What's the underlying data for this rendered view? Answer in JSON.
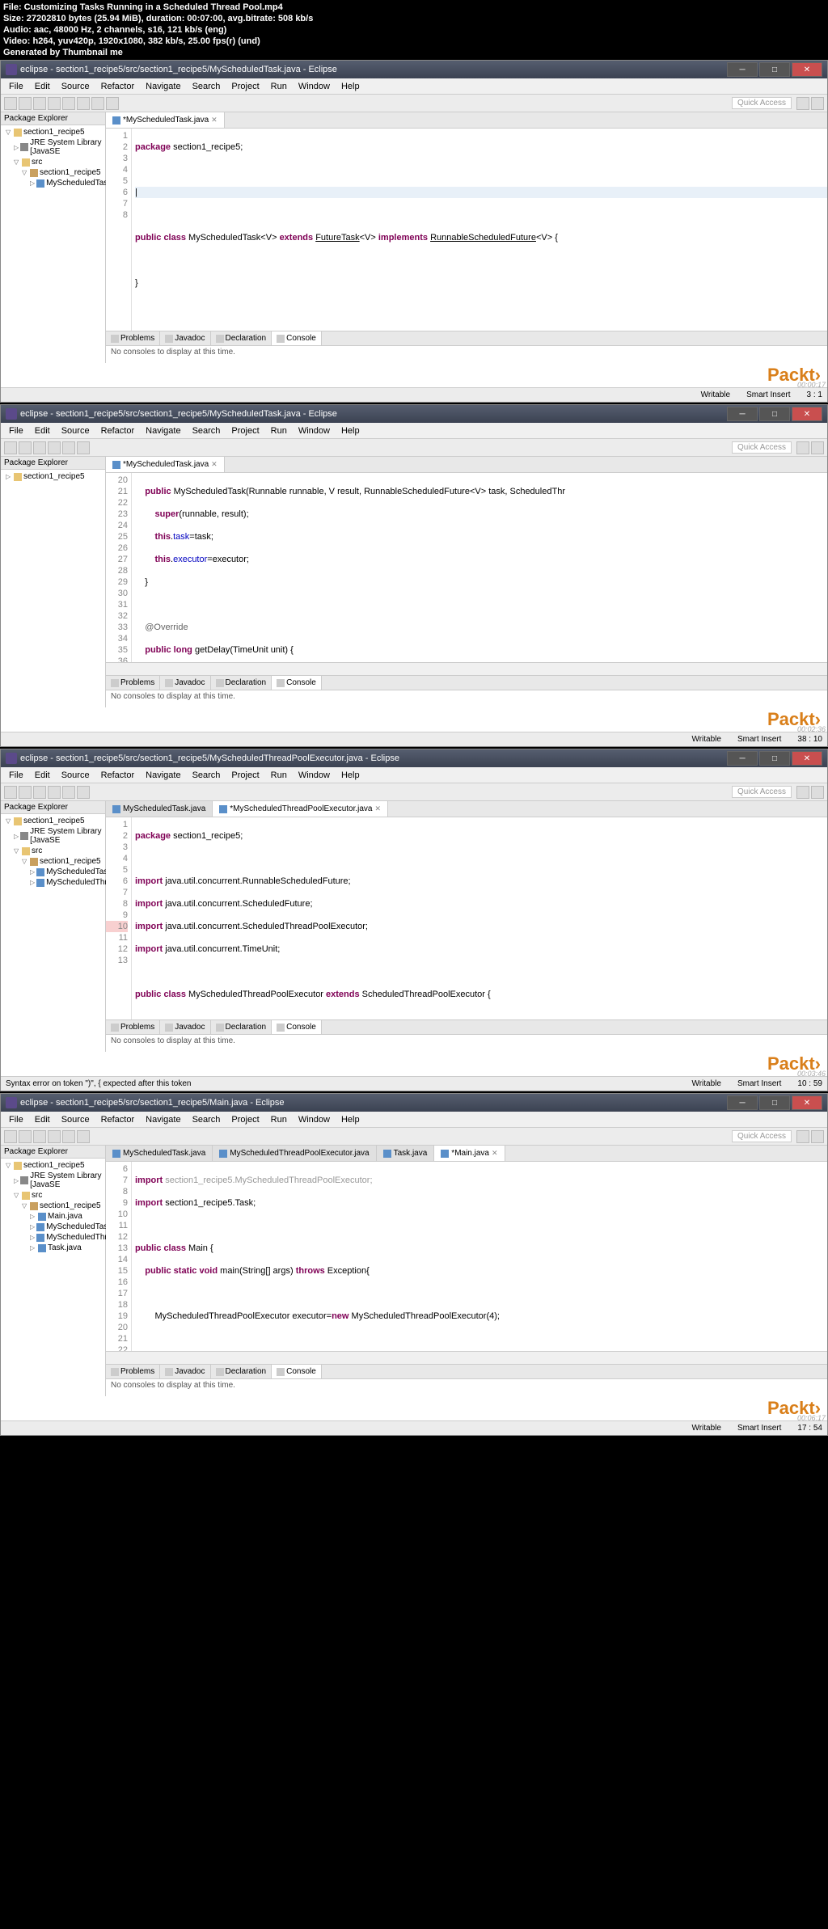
{
  "header": {
    "file": "File: Customizing Tasks Running in a Scheduled Thread Pool.mp4",
    "size": "Size: 27202810 bytes (25.94 MiB), duration: 00:07:00, avg.bitrate: 508 kb/s",
    "audio": "Audio: aac, 48000 Hz, 2 channels, s16, 121 kb/s (eng)",
    "video": "Video: h264, yuv420p, 1920x1080, 382 kb/s, 25.00 fps(r) (und)",
    "generated": "Generated by Thumbnail me"
  },
  "menu": [
    "File",
    "Edit",
    "Source",
    "Refactor",
    "Navigate",
    "Search",
    "Project",
    "Run",
    "Window",
    "Help"
  ],
  "quick_access": "Quick Access",
  "explorer_title": "Package Explorer",
  "console_tabs": [
    "Problems",
    "Javadoc",
    "Declaration",
    "Console"
  ],
  "console_msg": "No consoles to display at this time.",
  "logo": "Packt",
  "pane1": {
    "title": "eclipse - section1_recipe5/src/section1_recipe5/MyScheduledTask.java - Eclipse",
    "tab": "*MyScheduledTask.java",
    "tree": [
      "section1_recipe5",
      "JRE System Library [JavaSE",
      "src",
      "section1_recipe5",
      "MyScheduledTask.jav"
    ],
    "status": {
      "writable": "Writable",
      "insert": "Smart Insert",
      "pos": "3 : 1"
    },
    "time": "00:00:17"
  },
  "pane2": {
    "title": "eclipse - section1_recipe5/src/section1_recipe5/MyScheduledTask.java - Eclipse",
    "tab": "*MyScheduledTask.java",
    "tree": [
      "section1_recipe5"
    ],
    "status": {
      "writable": "Writable",
      "insert": "Smart Insert",
      "pos": "38 : 10"
    },
    "time": "00:02:36"
  },
  "pane3": {
    "title": "eclipse - section1_recipe5/src/section1_recipe5/MyScheduledThreadPoolExecutor.java - Eclipse",
    "tabs": [
      "MyScheduledTask.java",
      "*MyScheduledThreadPoolExecutor.java"
    ],
    "tree": [
      "section1_recipe5",
      "JRE System Library [JavaSE",
      "src",
      "section1_recipe5",
      "MyScheduledTask.jav",
      "MyScheduledThreadI"
    ],
    "status": {
      "err": "Syntax error on token \")\", { expected after this token",
      "writable": "Writable",
      "insert": "Smart Insert",
      "pos": "10 : 59"
    },
    "time": "00:03:46"
  },
  "pane4": {
    "title": "eclipse - section1_recipe5/src/section1_recipe5/Main.java - Eclipse",
    "tabs": [
      "MyScheduledTask.java",
      "MyScheduledThreadPoolExecutor.java",
      "Task.java",
      "*Main.java"
    ],
    "tree": [
      "section1_recipe5",
      "JRE System Library [JavaSE",
      "src",
      "section1_recipe5",
      "Main.java",
      "MyScheduledTask.jav",
      "MyScheduledThreadI",
      "Task.java"
    ],
    "status": {
      "writable": "Writable",
      "insert": "Smart Insert",
      "pos": "17 : 54"
    },
    "time": "00:06:17"
  }
}
